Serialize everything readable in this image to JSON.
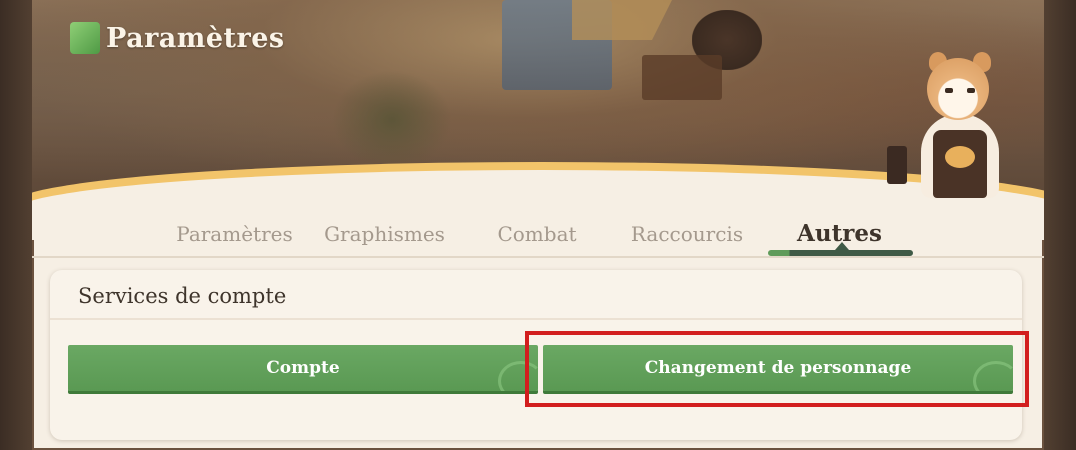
{
  "header": {
    "title": "Paramètres",
    "title_icon": "settings-leaf-icon"
  },
  "tabs": [
    {
      "label": "Paramètres",
      "active": false
    },
    {
      "label": "Graphismes",
      "active": false
    },
    {
      "label": "Combat",
      "active": false
    },
    {
      "label": "Raccourcis",
      "active": false
    },
    {
      "label": "Autres",
      "active": true
    }
  ],
  "account_services": {
    "title": "Services de compte",
    "buttons": {
      "account": "Compte",
      "character_change": "Changement de personnage"
    }
  },
  "colors": {
    "accent_green": "#5f9b5a",
    "highlight_red": "#d21e1e"
  }
}
